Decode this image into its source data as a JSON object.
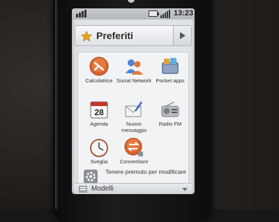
{
  "status_bar": {
    "time": "13:23"
  },
  "header": {
    "title": "Preferiti",
    "star_icon": "star-icon",
    "next_icon": "chevron-right-icon"
  },
  "apps": [
    {
      "label": "Calcolatrice",
      "icon": "calculator-icon"
    },
    {
      "label": "Social Network",
      "icon": "social-network-icon"
    },
    {
      "label": "Pocket apps",
      "icon": "pocket-apps-icon"
    },
    {
      "label": "Agenda",
      "icon": "calendar-icon"
    },
    {
      "label": "Nuovo messaggio",
      "icon": "new-message-icon"
    },
    {
      "label": "Radio FM",
      "icon": "radio-icon"
    },
    {
      "label": "Sveglia",
      "icon": "alarm-clock-icon"
    },
    {
      "label": "Convertitore",
      "icon": "converter-icon"
    }
  ],
  "calendar_day": "28",
  "hint": {
    "text": "Tenere premuto per modificare",
    "icon": "gear-icon"
  },
  "bottom_bar": {
    "label": "Modelli",
    "icon": "templates-icon"
  },
  "colors": {
    "screen_bg": "#dfe2e6",
    "accent_orange": "#d9622b",
    "star": "#e6a21a"
  }
}
